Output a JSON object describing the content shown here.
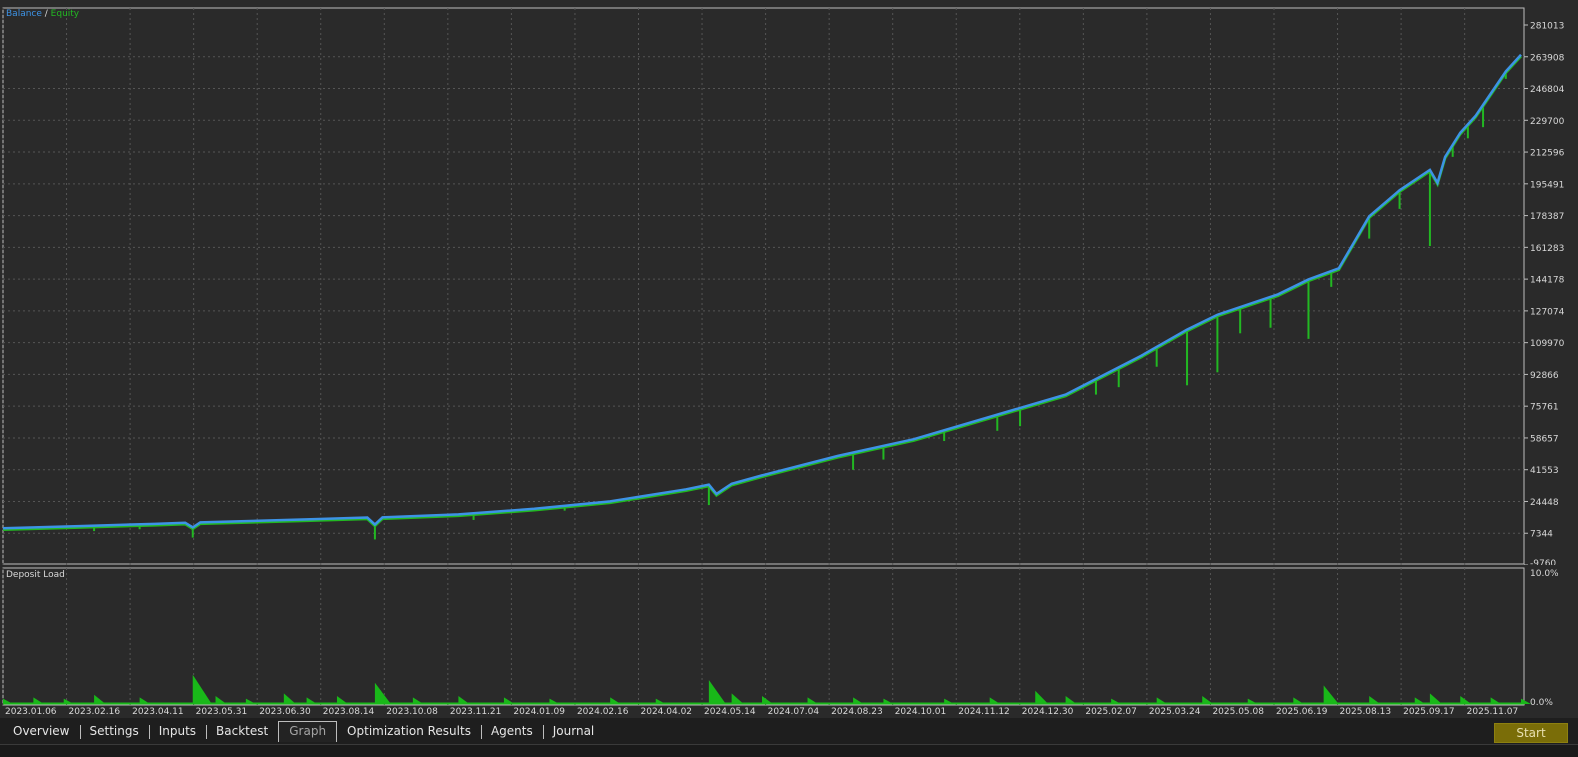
{
  "legend": {
    "balance": "Balance",
    "separator": " / ",
    "equity": "Equity"
  },
  "deposit_title": "Deposit Load",
  "tabs": [
    {
      "label": "Overview"
    },
    {
      "label": "Settings"
    },
    {
      "label": "Inputs"
    },
    {
      "label": "Backtest"
    },
    {
      "label": "Graph",
      "active": true
    },
    {
      "label": "Optimization Results"
    },
    {
      "label": "Agents"
    },
    {
      "label": "Journal"
    }
  ],
  "start_label": "Start",
  "colors": {
    "balance": "#3d93e6",
    "equity": "#22b822",
    "deposit_load": "#19b819",
    "background": "#2a2a2a",
    "grid": "#555555",
    "start_button": "#7a6d08"
  },
  "chart_data": [
    {
      "type": "line",
      "title": "",
      "series": [
        {
          "name": "Balance",
          "color": "#3d93e6"
        },
        {
          "name": "Equity",
          "color": "#22b822"
        }
      ],
      "x_tick_labels": [
        "2023.01.06",
        "2023.02.16",
        "2023.04.11",
        "2023.05.31",
        "2023.06.30",
        "2023.08.14",
        "2023.10.08",
        "2023.11.21",
        "2024.01.09",
        "2024.02.16",
        "2024.04.02",
        "2024.05.14",
        "2024.07.04",
        "2024.08.23",
        "2024.10.01",
        "2024.11.12",
        "2024.12.30",
        "2025.02.07",
        "2025.03.24",
        "2025.05.08",
        "2025.06.19",
        "2025.08.13",
        "2025.09.17",
        "2025.11.07"
      ],
      "y_tick_labels": [
        "281013",
        "263908",
        "246804",
        "229700",
        "212596",
        "195491",
        "178387",
        "161283",
        "144178",
        "127074",
        "109970",
        "92866",
        "75761",
        "58657",
        "41553",
        "24448",
        "7344",
        "-9760"
      ],
      "ylim": [
        -9760,
        281013
      ],
      "grid": true,
      "legend_position": "top-left",
      "balance_points": [
        [
          0,
          10000
        ],
        [
          0.05,
          11200
        ],
        [
          0.1,
          12400
        ],
        [
          0.12,
          13000
        ],
        [
          0.125,
          10500
        ],
        [
          0.13,
          13200
        ],
        [
          0.2,
          14800
        ],
        [
          0.24,
          15800
        ],
        [
          0.245,
          12000
        ],
        [
          0.25,
          15900
        ],
        [
          0.3,
          17500
        ],
        [
          0.35,
          20500
        ],
        [
          0.4,
          24500
        ],
        [
          0.45,
          31000
        ],
        [
          0.465,
          33500
        ],
        [
          0.47,
          28500
        ],
        [
          0.48,
          34000
        ],
        [
          0.5,
          38500
        ],
        [
          0.55,
          49000
        ],
        [
          0.6,
          58000
        ],
        [
          0.65,
          70000
        ],
        [
          0.7,
          82000
        ],
        [
          0.75,
          103000
        ],
        [
          0.78,
          117000
        ],
        [
          0.8,
          125000
        ],
        [
          0.84,
          136000
        ],
        [
          0.86,
          144000
        ],
        [
          0.88,
          150000
        ],
        [
          0.9,
          178000
        ],
        [
          0.92,
          192000
        ],
        [
          0.94,
          203000
        ],
        [
          0.945,
          196000
        ],
        [
          0.95,
          210000
        ],
        [
          0.96,
          223000
        ],
        [
          0.97,
          232000
        ],
        [
          0.98,
          244000
        ],
        [
          0.99,
          256000
        ],
        [
          1.0,
          265000
        ]
      ],
      "equity_dips": [
        [
          0.06,
          8500
        ],
        [
          0.09,
          9500
        ],
        [
          0.125,
          5000
        ],
        [
          0.18,
          13000
        ],
        [
          0.245,
          4000
        ],
        [
          0.31,
          14500
        ],
        [
          0.37,
          19500
        ],
        [
          0.41,
          25500
        ],
        [
          0.465,
          22500
        ],
        [
          0.56,
          41500
        ],
        [
          0.58,
          47000
        ],
        [
          0.62,
          57000
        ],
        [
          0.655,
          62500
        ],
        [
          0.67,
          65000
        ],
        [
          0.72,
          82000
        ],
        [
          0.735,
          86000
        ],
        [
          0.76,
          97000
        ],
        [
          0.78,
          87000
        ],
        [
          0.8,
          94000
        ],
        [
          0.815,
          115000
        ],
        [
          0.835,
          118000
        ],
        [
          0.86,
          112000
        ],
        [
          0.875,
          140000
        ],
        [
          0.9,
          166000
        ],
        [
          0.92,
          182000
        ],
        [
          0.94,
          162000
        ],
        [
          0.955,
          210000
        ],
        [
          0.965,
          220000
        ],
        [
          0.975,
          226000
        ],
        [
          0.99,
          252000
        ]
      ]
    },
    {
      "type": "area",
      "title": "Deposit Load",
      "y_tick_labels": [
        "10.0%",
        "0.0%"
      ],
      "ylim": [
        0,
        10
      ],
      "spikes": [
        [
          0.0,
          0.4
        ],
        [
          0.02,
          0.5
        ],
        [
          0.04,
          0.4
        ],
        [
          0.06,
          0.7
        ],
        [
          0.09,
          0.5
        ],
        [
          0.125,
          2.2
        ],
        [
          0.14,
          0.6
        ],
        [
          0.16,
          0.4
        ],
        [
          0.185,
          0.8
        ],
        [
          0.2,
          0.5
        ],
        [
          0.22,
          0.6
        ],
        [
          0.245,
          1.6
        ],
        [
          0.27,
          0.5
        ],
        [
          0.3,
          0.6
        ],
        [
          0.33,
          0.5
        ],
        [
          0.36,
          0.4
        ],
        [
          0.4,
          0.5
        ],
        [
          0.43,
          0.4
        ],
        [
          0.465,
          1.8
        ],
        [
          0.48,
          0.8
        ],
        [
          0.5,
          0.6
        ],
        [
          0.53,
          0.5
        ],
        [
          0.56,
          0.5
        ],
        [
          0.58,
          0.4
        ],
        [
          0.62,
          0.4
        ],
        [
          0.65,
          0.5
        ],
        [
          0.68,
          1.0
        ],
        [
          0.7,
          0.6
        ],
        [
          0.73,
          0.4
        ],
        [
          0.76,
          0.5
        ],
        [
          0.79,
          0.6
        ],
        [
          0.82,
          0.4
        ],
        [
          0.85,
          0.5
        ],
        [
          0.87,
          1.4
        ],
        [
          0.9,
          0.6
        ],
        [
          0.93,
          0.5
        ],
        [
          0.94,
          0.8
        ],
        [
          0.96,
          0.6
        ],
        [
          0.98,
          0.5
        ],
        [
          1.0,
          0.4
        ]
      ]
    }
  ]
}
